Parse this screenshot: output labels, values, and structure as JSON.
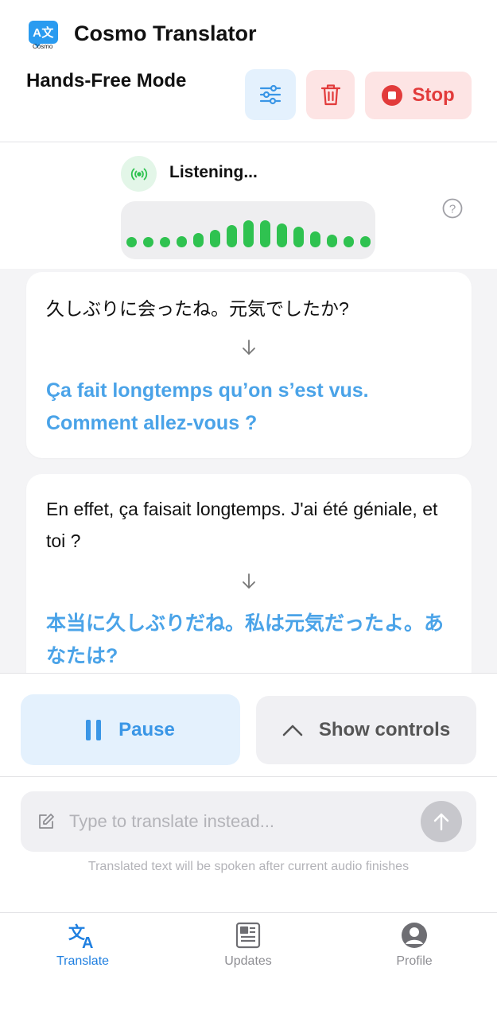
{
  "header": {
    "logo_text": "A文",
    "logo_caption": "Cosmo",
    "app_title": "Cosmo Translator",
    "mode_title": "Hands-Free Mode",
    "stop_label": "Stop"
  },
  "listening": {
    "status": "Listening...",
    "wave_levels": [
      0.25,
      0.3,
      0.3,
      0.35,
      0.45,
      0.55,
      0.7,
      0.85,
      0.85,
      0.75,
      0.65,
      0.5,
      0.4,
      0.35,
      0.35
    ]
  },
  "conversation": [
    {
      "source": "久しぶりに会ったね。元気でしたか?",
      "translation": "Ça fait longtemps qu’on s’est vus. Comment allez-vous ?"
    },
    {
      "source": "En effet, ça faisait longtemps. J'ai été géniale, et toi ?",
      "translation": "本当に久しぶりだね。私は元気だったよ。あなたは?"
    }
  ],
  "controls": {
    "pause_label": "Pause",
    "show_controls_label": "Show controls"
  },
  "input": {
    "placeholder": "Type to translate instead...",
    "value": "",
    "hint": "Translated text will be spoken after current audio finishes"
  },
  "tabs": [
    {
      "label": "Translate",
      "active": true
    },
    {
      "label": "Updates",
      "active": false
    },
    {
      "label": "Profile",
      "active": false
    }
  ],
  "colors": {
    "accent": "#3a96e6",
    "danger": "#e23b3b",
    "listening": "#2fc250",
    "translation_text": "#4aa3e8"
  }
}
